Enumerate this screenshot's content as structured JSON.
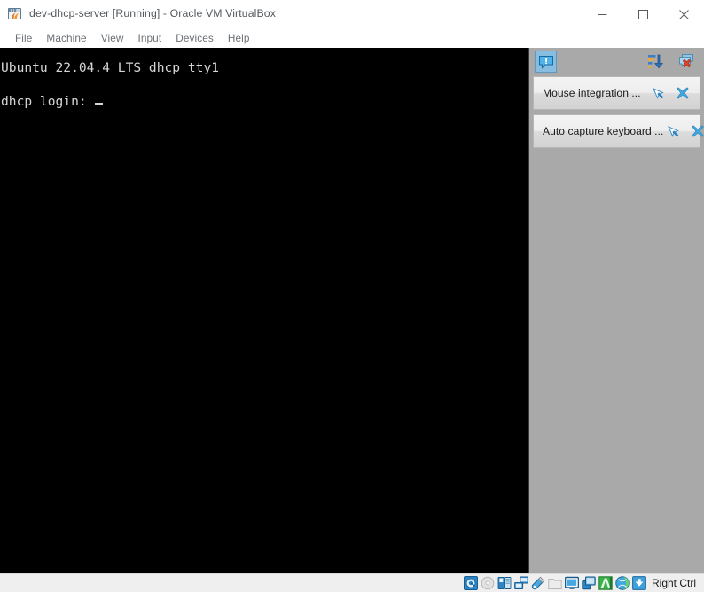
{
  "window": {
    "title": "dev-dhcp-server [Running] - Oracle VM VirtualBox",
    "app_icon": "virtualbox-icon",
    "controls": {
      "minimize": "minimize-icon",
      "maximize": "maximize-icon",
      "close": "close-icon"
    }
  },
  "menubar": {
    "items": [
      {
        "label": "File"
      },
      {
        "label": "Machine"
      },
      {
        "label": "View"
      },
      {
        "label": "Input"
      },
      {
        "label": "Devices"
      },
      {
        "label": "Help"
      }
    ]
  },
  "vm_screen": {
    "background_color": "#000000",
    "text_color": "#d6d6d6",
    "lines": [
      "Ubuntu 22.04.4 LTS dhcp tty1",
      "dhcp login: "
    ],
    "cursor_visible": true
  },
  "notification_panel": {
    "background_color": "#a9a9a9",
    "header": {
      "toggle_icon": "notification-bubble-icon",
      "toggle_active": true,
      "sort_icon": "sort-descending-icon",
      "clear_icon": "clear-all-notifications-icon"
    },
    "items": [
      {
        "text": "Mouse integration ...",
        "keep_icon": "pin-notification-icon",
        "close_icon": "close-notification-icon"
      },
      {
        "text": "Auto capture keyboard ...",
        "keep_icon": "pin-notification-icon",
        "close_icon": "close-notification-icon"
      }
    ]
  },
  "statusbar": {
    "icons": [
      {
        "name": "hard-disk-icon",
        "enabled": true
      },
      {
        "name": "optical-drive-icon",
        "enabled": false
      },
      {
        "name": "floppy-drive-icon",
        "enabled": true
      },
      {
        "name": "network-icon",
        "enabled": true
      },
      {
        "name": "usb-icon",
        "enabled": true
      },
      {
        "name": "shared-folders-icon",
        "enabled": false
      },
      {
        "name": "display-icon",
        "enabled": true
      },
      {
        "name": "video-capture-icon",
        "enabled": true
      },
      {
        "name": "virtualization-icon",
        "enabled": true
      },
      {
        "name": "mouse-integration-icon",
        "enabled": true
      },
      {
        "name": "host-key-icon",
        "enabled": true
      }
    ],
    "host_key_label": "Right Ctrl"
  }
}
